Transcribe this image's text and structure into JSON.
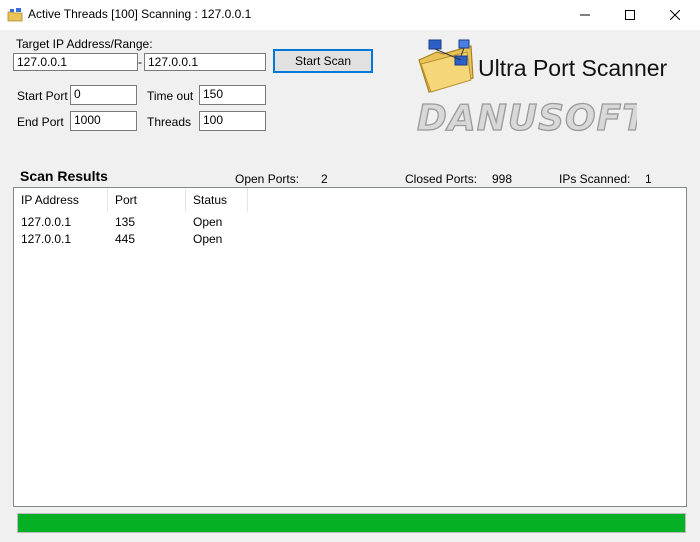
{
  "window": {
    "title": "Active Threads [100] Scanning : 127.0.0.1"
  },
  "form": {
    "target_label": "Target IP Address/Range:",
    "ip_from": "127.0.0.1",
    "range_sep": "-",
    "ip_to": "127.0.0.1",
    "start_port_label": "Start Port",
    "start_port": "0",
    "timeout_label": "Time out",
    "timeout": "150",
    "end_port_label": "End Port",
    "end_port": "1000",
    "threads_label": "Threads",
    "threads": "100",
    "start_button": "Start Scan"
  },
  "logo": {
    "title": "Ultra Port Scanner",
    "brand": "DANUSOFT",
    "icon": "folder-network-icon"
  },
  "results": {
    "title": "Scan Results",
    "open_label": "Open Ports:",
    "open_value": "2",
    "closed_label": "Closed Ports:",
    "closed_value": "998",
    "scanned_label": "IPs Scanned:",
    "scanned_value": "1",
    "columns": [
      "IP Address",
      "Port",
      "Status"
    ],
    "rows": [
      {
        "ip": "127.0.0.1",
        "port": "135",
        "status": "Open"
      },
      {
        "ip": "127.0.0.1",
        "port": "445",
        "status": "Open"
      }
    ]
  },
  "progress": {
    "percent": 100,
    "color": "#06b025"
  }
}
